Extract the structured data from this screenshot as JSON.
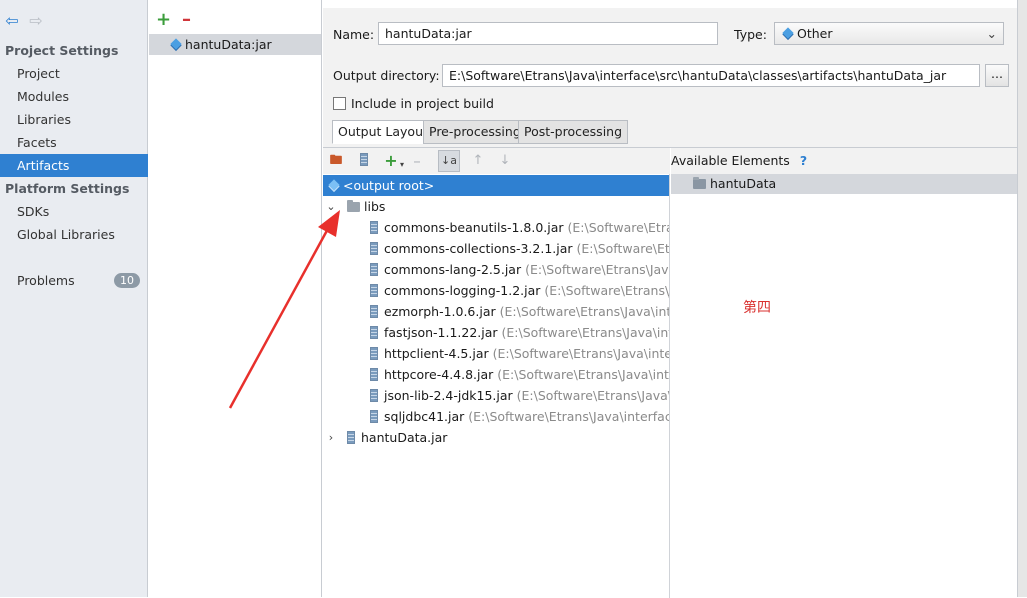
{
  "nav": {
    "section_project": "Project Settings",
    "project_items": [
      "Project",
      "Modules",
      "Libraries",
      "Facets",
      "Artifacts"
    ],
    "selected_item": "Artifacts",
    "section_platform": "Platform Settings",
    "platform_items": [
      "SDKs",
      "Global Libraries"
    ],
    "problems_label": "Problems",
    "problems_count": "10"
  },
  "artifacts": {
    "items": [
      "hantuData:jar"
    ]
  },
  "details": {
    "name_label": "Name:",
    "name_value": "hantuData:jar",
    "type_label": "Type:",
    "type_value": "Other",
    "output_dir_label": "Output directory:",
    "output_dir_value": "E:\\Software\\Etrans\\Java\\interface\\src\\hantuData\\classes\\artifacts\\hantuData_jar",
    "browse_label": "...",
    "include_label": "Include in project build",
    "include_checked": false,
    "tabs": [
      "Output Layout",
      "Pre-processing",
      "Post-processing"
    ],
    "selected_tab": "Output Layout"
  },
  "layout": {
    "output_root": "<output root>",
    "libs_folder": "libs",
    "libs": [
      {
        "name": "commons-beanutils-1.8.0.jar",
        "path": "(E:\\Software\\Etrans\\Ja"
      },
      {
        "name": "commons-collections-3.2.1.jar",
        "path": "(E:\\Software\\Etrans"
      },
      {
        "name": "commons-lang-2.5.jar",
        "path": "(E:\\Software\\Etrans\\Java\\in"
      },
      {
        "name": "commons-logging-1.2.jar",
        "path": "(E:\\Software\\Etrans\\Java"
      },
      {
        "name": "ezmorph-1.0.6.jar",
        "path": "(E:\\Software\\Etrans\\Java\\interfa"
      },
      {
        "name": "fastjson-1.1.22.jar",
        "path": "(E:\\Software\\Etrans\\Java\\interfa"
      },
      {
        "name": "httpclient-4.5.jar",
        "path": "(E:\\Software\\Etrans\\Java\\interfac"
      },
      {
        "name": "httpcore-4.4.8.jar",
        "path": "(E:\\Software\\Etrans\\Java\\interfa"
      },
      {
        "name": "json-lib-2.4-jdk15.jar",
        "path": "(E:\\Software\\Etrans\\Java\\inte"
      },
      {
        "name": "sqljdbc41.jar",
        "path": "(E:\\Software\\Etrans\\Java\\interface\\s"
      }
    ],
    "jar_entry": "hantuData.jar",
    "available_label": "Available Elements",
    "help_mark": "?",
    "available_items": [
      "hantuData"
    ],
    "annotation": "第四"
  },
  "colors": {
    "selection": "#2f80d1",
    "annotation_arrow": "#e8302c"
  }
}
